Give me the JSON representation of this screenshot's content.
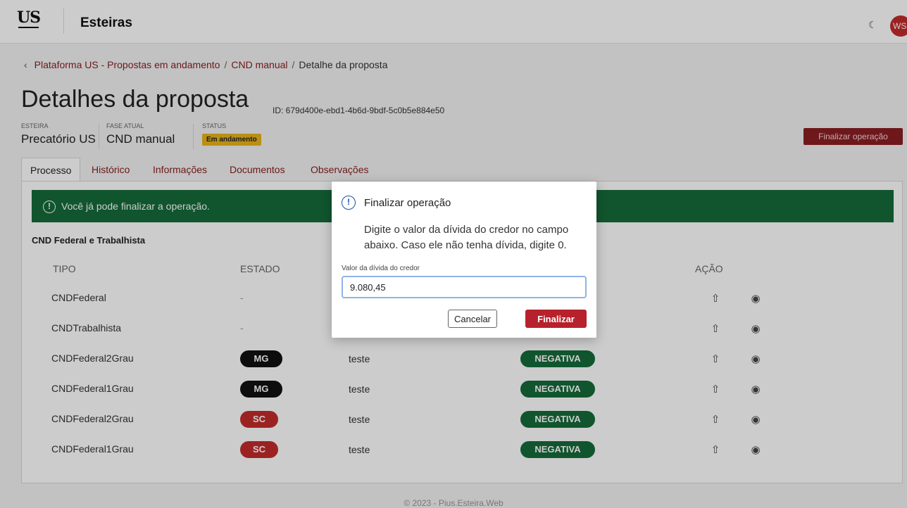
{
  "header": {
    "logo_text": "US",
    "app_title": "Esteiras",
    "theme_icon": "moon-icon",
    "avatar_initials": "WS"
  },
  "breadcrumb": {
    "items": [
      "Plataforma US - Propostas em andamento",
      "CND manual"
    ],
    "current": "Detalhe da proposta",
    "separator": "/"
  },
  "page": {
    "title": "Detalhes da proposta",
    "id_text": "ID: 679d400e-ebd1-4b6d-9bdf-5c0b5e884e50",
    "meta": [
      {
        "label": "ESTEIRA",
        "value": "Precatório US"
      },
      {
        "label": "FASE ATUAL",
        "value": "CND manual"
      },
      {
        "label": "STATUS",
        "value": "Em andamento"
      }
    ],
    "finalize_button": "Finalizar operação"
  },
  "tabs": [
    "Processo",
    "Histórico",
    "Informações",
    "Documentos",
    "Observações"
  ],
  "alert": {
    "icon": "exclamation-circle-icon",
    "text": "Você já pode finalizar a operação."
  },
  "section": {
    "title": "CND Federal e Trabalhista",
    "columns": {
      "tipo": "TIPO",
      "estado": "ESTADO",
      "acao": "AÇÃO"
    },
    "rows": [
      {
        "tipo": "CNDFederal",
        "estado": "-",
        "obs": "",
        "result": ""
      },
      {
        "tipo": "CNDTrabalhista",
        "estado": "-",
        "obs": "",
        "result": ""
      },
      {
        "tipo": "CNDFederal2Grau",
        "estado": "MG",
        "obs": "teste",
        "result": "NEGATIVA"
      },
      {
        "tipo": "CNDFederal1Grau",
        "estado": "MG",
        "obs": "teste",
        "result": "NEGATIVA"
      },
      {
        "tipo": "CNDFederal2Grau",
        "estado": "SC",
        "obs": "teste",
        "result": "NEGATIVA"
      },
      {
        "tipo": "CNDFederal1Grau",
        "estado": "SC",
        "obs": "teste",
        "result": "NEGATIVA"
      }
    ]
  },
  "modal": {
    "title": "Finalizar operação",
    "message": "Digite o valor da dívida do credor no campo abaixo. Caso ele não tenha dívida, digite 0.",
    "field_label": "Valor da dívida do credor",
    "field_value": "9.080,45",
    "cancel_label": "Cancelar",
    "confirm_label": "Finalizar"
  },
  "footer": {
    "text": "© 2023 - Pius.Esteira.Web"
  },
  "colors": {
    "brand": "#8a1e24",
    "success": "#146b3a",
    "status_badge": "#e8b41c",
    "danger": "#b7212b"
  }
}
